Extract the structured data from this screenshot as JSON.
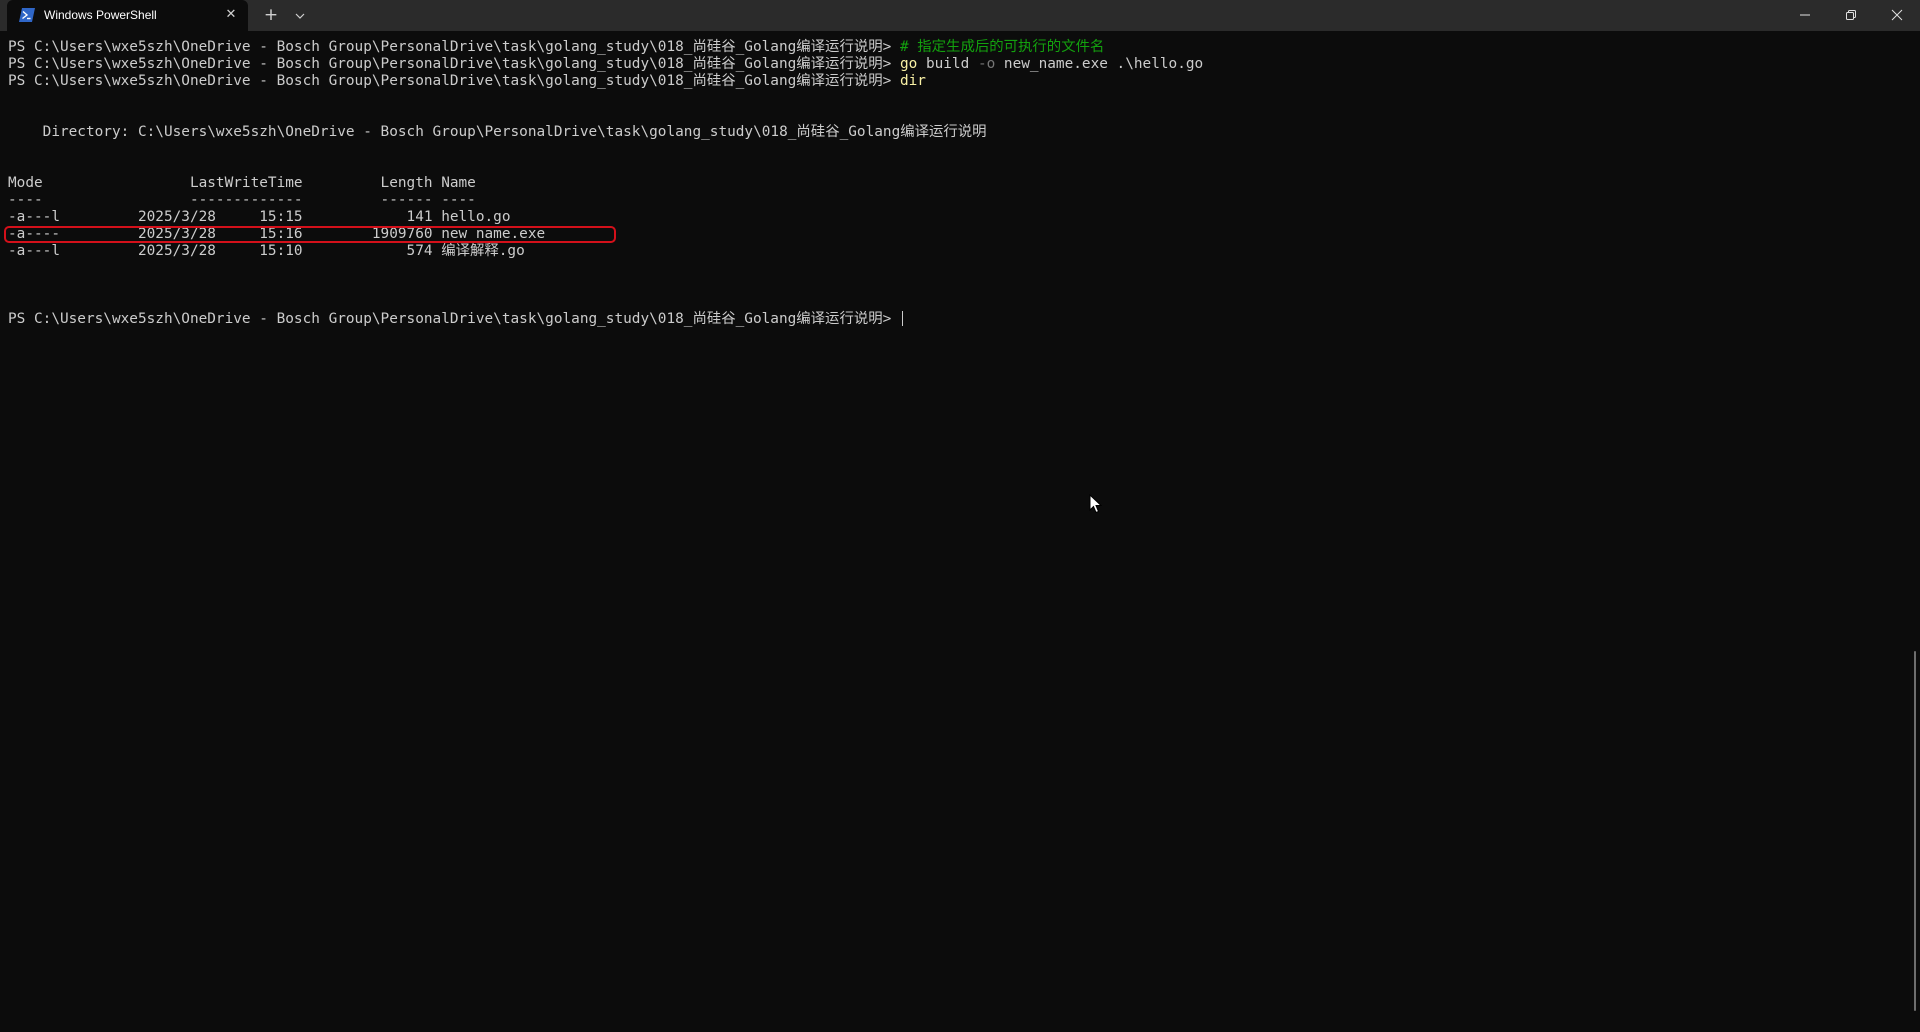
{
  "window": {
    "tab_title": "Windows PowerShell",
    "tab_icon": "powershell-icon",
    "close_tab_symbol": "✕",
    "new_tab_symbol": "+",
    "dropdown_icon": "chevron-down-icon",
    "controls": [
      "minimize-icon",
      "restore-icon",
      "close-icon"
    ]
  },
  "colors": {
    "background": "#0c0c0c",
    "titlebar": "#2b2b2b",
    "text": "#cccccc",
    "command": "#f9f1a5",
    "parameter": "#767676",
    "comment": "#13a10e",
    "highlight": "#d4101a"
  },
  "terminal": {
    "prompt": "PS C:\\Users\\wxe5szh\\OneDrive - Bosch Group\\PersonalDrive\\task\\golang_study\\018_尚硅谷_Golang编译运行说明> ",
    "history": [
      {
        "comment": "# 指定生成后的可执行的文件名"
      },
      {
        "command": "go",
        "args_before": " build ",
        "param": "-o",
        "args_after": " new_name.exe .\\hello.go"
      },
      {
        "command": "dir"
      }
    ],
    "directory_line": "    Directory: C:\\Users\\wxe5szh\\OneDrive - Bosch Group\\PersonalDrive\\task\\golang_study\\018_尚硅谷_Golang编译运行说明",
    "listing": {
      "header": "Mode                 LastWriteTime         Length Name",
      "separator": "----                 -------------         ------ ----",
      "rows": [
        {
          "mode": "-a---l",
          "date": "2025/3/28",
          "time": "15:15",
          "length": "141",
          "name": "hello.go",
          "text": "-a---l         2025/3/28     15:15            141 hello.go"
        },
        {
          "mode": "-a----",
          "date": "2025/3/28",
          "time": "15:16",
          "length": "1909760",
          "name": "new_name.exe",
          "text": "-a----         2025/3/28     15:16        1909760 new_name.exe"
        },
        {
          "mode": "-a---l",
          "date": "2025/3/28",
          "time": "15:10",
          "length": "574",
          "name": "编译解释.go",
          "text": "-a---l         2025/3/28     15:10            574 编译解释.go"
        }
      ]
    },
    "highlighted_row": 1
  }
}
